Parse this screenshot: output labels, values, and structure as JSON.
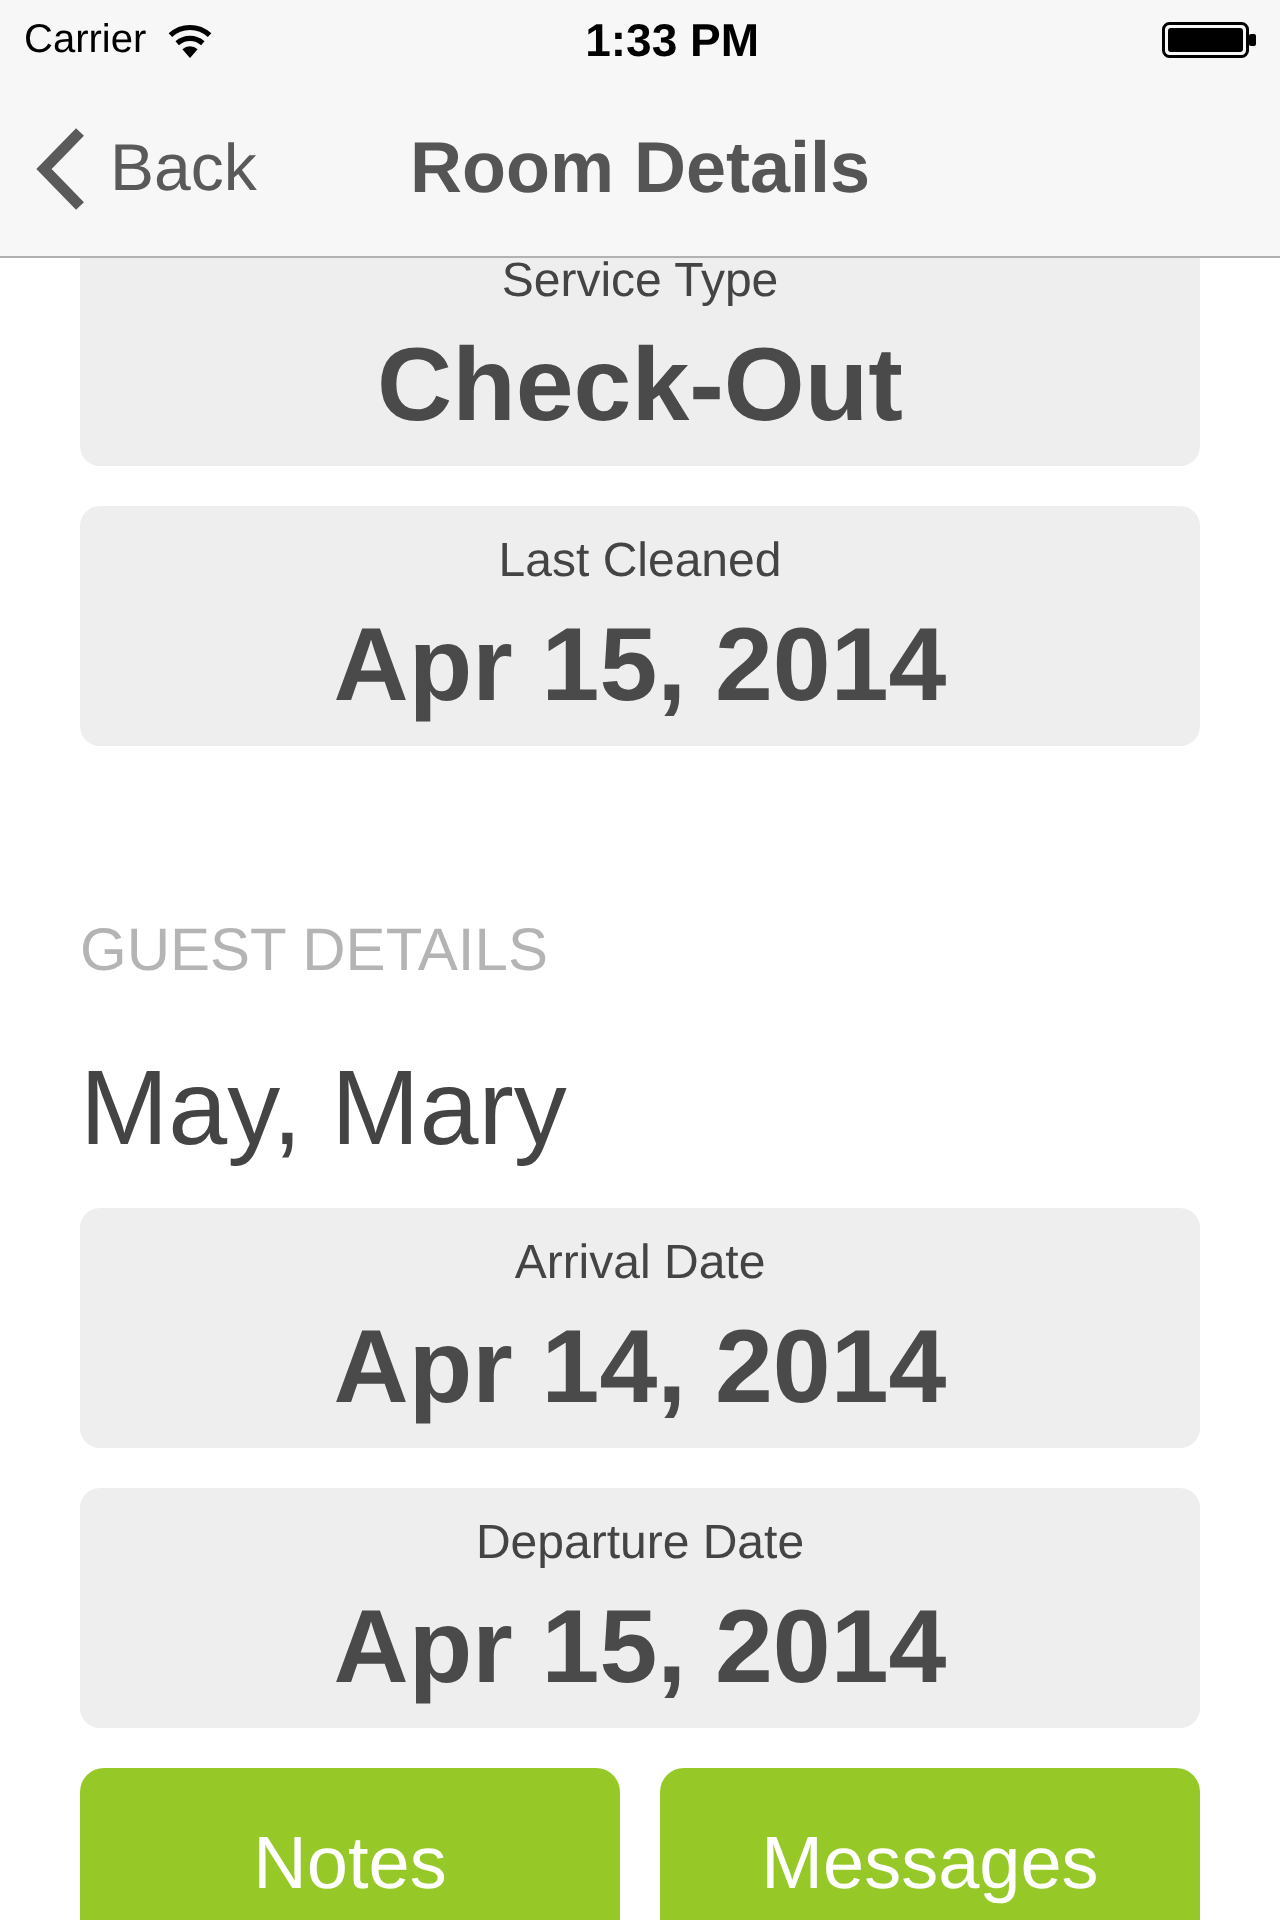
{
  "status_bar": {
    "carrier": "Carrier",
    "time": "1:33 PM"
  },
  "nav_bar": {
    "back": "Back",
    "title": "Room Details"
  },
  "room_cards": [
    {
      "label": "Service Type",
      "value": "Check-Out"
    },
    {
      "label": "Last Cleaned",
      "value": "Apr 15, 2014"
    }
  ],
  "guest_details": {
    "heading": "GUEST DETAILS",
    "name": "May, Mary",
    "cards": [
      {
        "label": "Arrival Date",
        "value": "Apr 14, 2014"
      },
      {
        "label": "Departure Date",
        "value": "Apr 15, 2014"
      }
    ]
  },
  "buttons": [
    "Notes",
    "Messages"
  ]
}
